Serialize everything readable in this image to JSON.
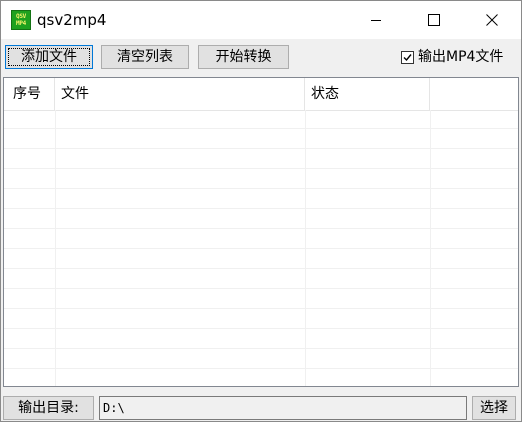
{
  "window": {
    "title": "qsv2mp4",
    "icon_lines": [
      "QSV",
      "MP4"
    ]
  },
  "toolbar": {
    "add_label": "添加文件",
    "clear_label": "清空列表",
    "start_label": "开始转换",
    "output_mp4_label": "输出MP4文件",
    "output_mp4_checked": true
  },
  "list": {
    "columns": [
      "序号",
      "文件",
      "状态",
      ""
    ],
    "rows": []
  },
  "bottom": {
    "output_dir_label": "输出目录:",
    "output_dir_value": "D:\\",
    "select_label": "选择"
  },
  "colors": {
    "accent": "#0078d7",
    "icon_bg": "#1ea11e",
    "icon_text": "#f3f36a"
  }
}
